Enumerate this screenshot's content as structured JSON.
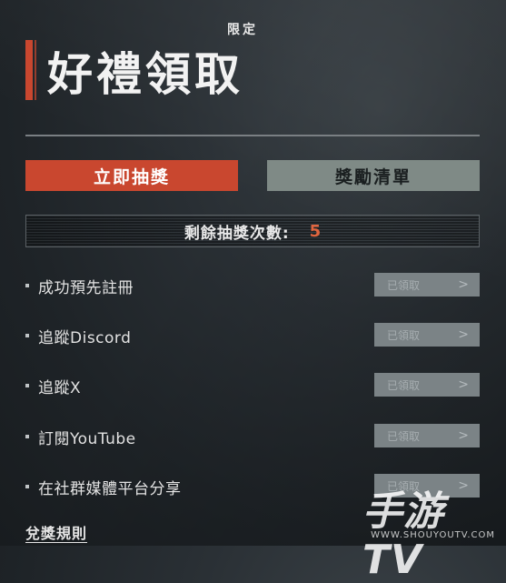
{
  "header": {
    "badge": "限定",
    "title": "好禮領取"
  },
  "buttons": {
    "draw_now": "立即抽獎",
    "reward_list": "獎勵清單"
  },
  "draw_count": {
    "label": "剩餘抽獎次數:",
    "value": "5"
  },
  "tasks": [
    {
      "label": "成功預先註冊",
      "status": "已領取"
    },
    {
      "label": "追蹤Discord",
      "status": "已領取"
    },
    {
      "label": "追蹤X",
      "status": "已領取"
    },
    {
      "label": "訂閱YouTube",
      "status": "已領取"
    },
    {
      "label": "在社群媒體平台分享",
      "status": "已領取"
    }
  ],
  "footer": {
    "rules_link": "兌獎規則"
  },
  "watermark": {
    "main": "手游TV",
    "sub": "WWW.SHOUYOUTV.COM"
  },
  "colors": {
    "accent": "#c9472f",
    "secondary_button": "#7f8a86",
    "count_value": "#e0653f"
  }
}
